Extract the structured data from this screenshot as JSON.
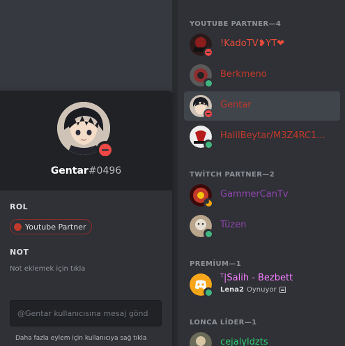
{
  "popout": {
    "username": "Gentar",
    "discriminator": "#0496",
    "role_section": "ROL",
    "role": {
      "label": "Youtube Partner",
      "color": "#c0392b"
    },
    "note_section": "NOT",
    "note_placeholder": "Not eklemek için tıkla",
    "message_placeholder": "@Gentar kullanıcısına mesaj gönd",
    "bottom_hint": "Daha fazla eylem için kullanıcıya sağ tıkla"
  },
  "member_list": {
    "groups": [
      {
        "title": "YOUTUBE PARTNER—4",
        "members": [
          {
            "name": "!KadoTV❥YT❤",
            "color": "#e74c3c",
            "status": "dnd",
            "avatar_icon": "kado-avatar"
          },
          {
            "name": "Berkmeno",
            "color": "#c0392b",
            "status": "online",
            "avatar_icon": "berkmeno-avatar"
          },
          {
            "name": "Gentar",
            "color": "#c0392b",
            "status": "dnd",
            "avatar_icon": "gentar-avatar",
            "selected": true
          },
          {
            "name": "HalilBeytar/M3Z4RC1...",
            "color": "#c0392b",
            "status": "online",
            "avatar_icon": "halil-avatar"
          }
        ]
      },
      {
        "title": "TWİTCH PARTNER—2",
        "members": [
          {
            "name": "GammerCanTv",
            "color": "#8e44ad",
            "status": "idle",
            "avatar_icon": "gammer-avatar"
          },
          {
            "name": "Tüzen",
            "color": "#8e44ad",
            "status": "online",
            "avatar_icon": "tuzen-avatar"
          }
        ]
      },
      {
        "title": "PREMİUM—1",
        "members": [
          {
            "name": "ᵀ|Salih - Bezbett",
            "color": "#f47fff",
            "status": "online",
            "avatar_icon": "discord-avatar",
            "activity_user": "Lena2",
            "activity_text": "Oynuyor"
          }
        ]
      },
      {
        "title": "LONCA LİDER—1",
        "members": [
          {
            "name": "cejalyldzts",
            "color": "#2ecc71",
            "status": "online",
            "avatar_icon": "ceja-avatar"
          }
        ]
      }
    ]
  }
}
